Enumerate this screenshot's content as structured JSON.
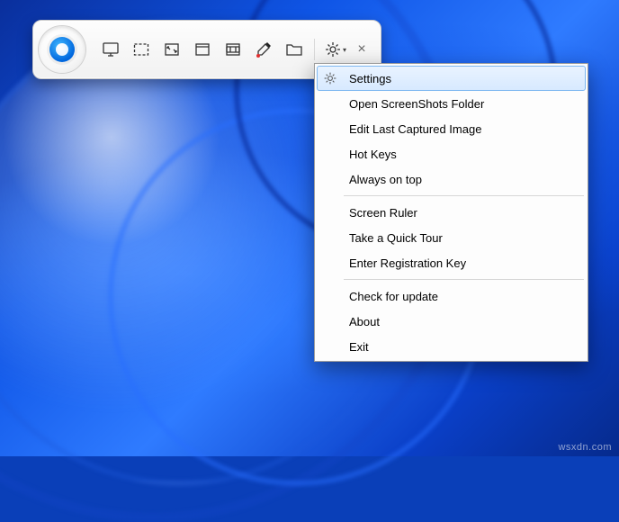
{
  "watermark": "wsxdn.com",
  "toolbar": {
    "buttons": [
      {
        "name": "capture-desktop-icon"
      },
      {
        "name": "capture-region-icon"
      },
      {
        "name": "capture-fullscreen-icon"
      },
      {
        "name": "capture-window-icon"
      },
      {
        "name": "capture-video-icon"
      },
      {
        "name": "color-picker-icon"
      },
      {
        "name": "open-folder-icon"
      },
      {
        "name": "settings-gear-icon"
      }
    ]
  },
  "menu": {
    "items": [
      {
        "label": "Settings",
        "icon": "gear",
        "selected": true
      },
      {
        "label": "Open ScreenShots Folder"
      },
      {
        "label": "Edit Last Captured Image"
      },
      {
        "label": "Hot Keys"
      },
      {
        "label": "Always on top"
      },
      {
        "sep": true
      },
      {
        "label": "Screen Ruler"
      },
      {
        "label": "Take a Quick Tour"
      },
      {
        "label": "Enter Registration Key"
      },
      {
        "sep": true
      },
      {
        "label": "Check for update"
      },
      {
        "label": "About"
      },
      {
        "label": "Exit"
      }
    ]
  }
}
